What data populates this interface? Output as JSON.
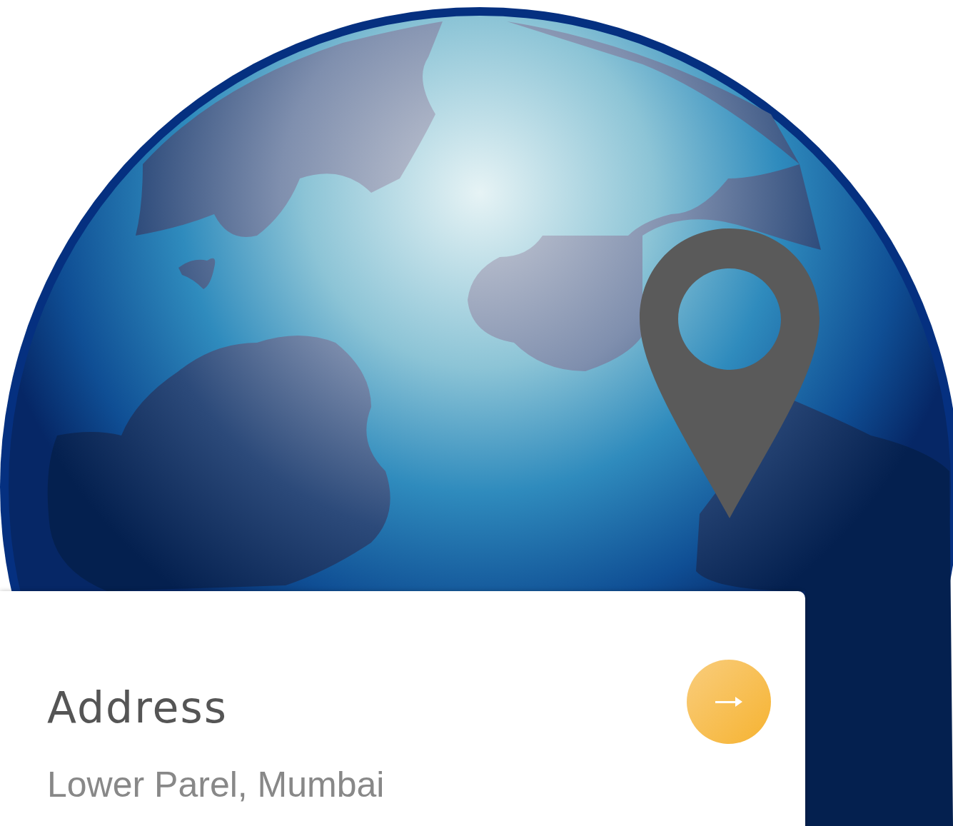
{
  "card": {
    "title": "Address",
    "text": "Lower Parel, Mumbai"
  }
}
